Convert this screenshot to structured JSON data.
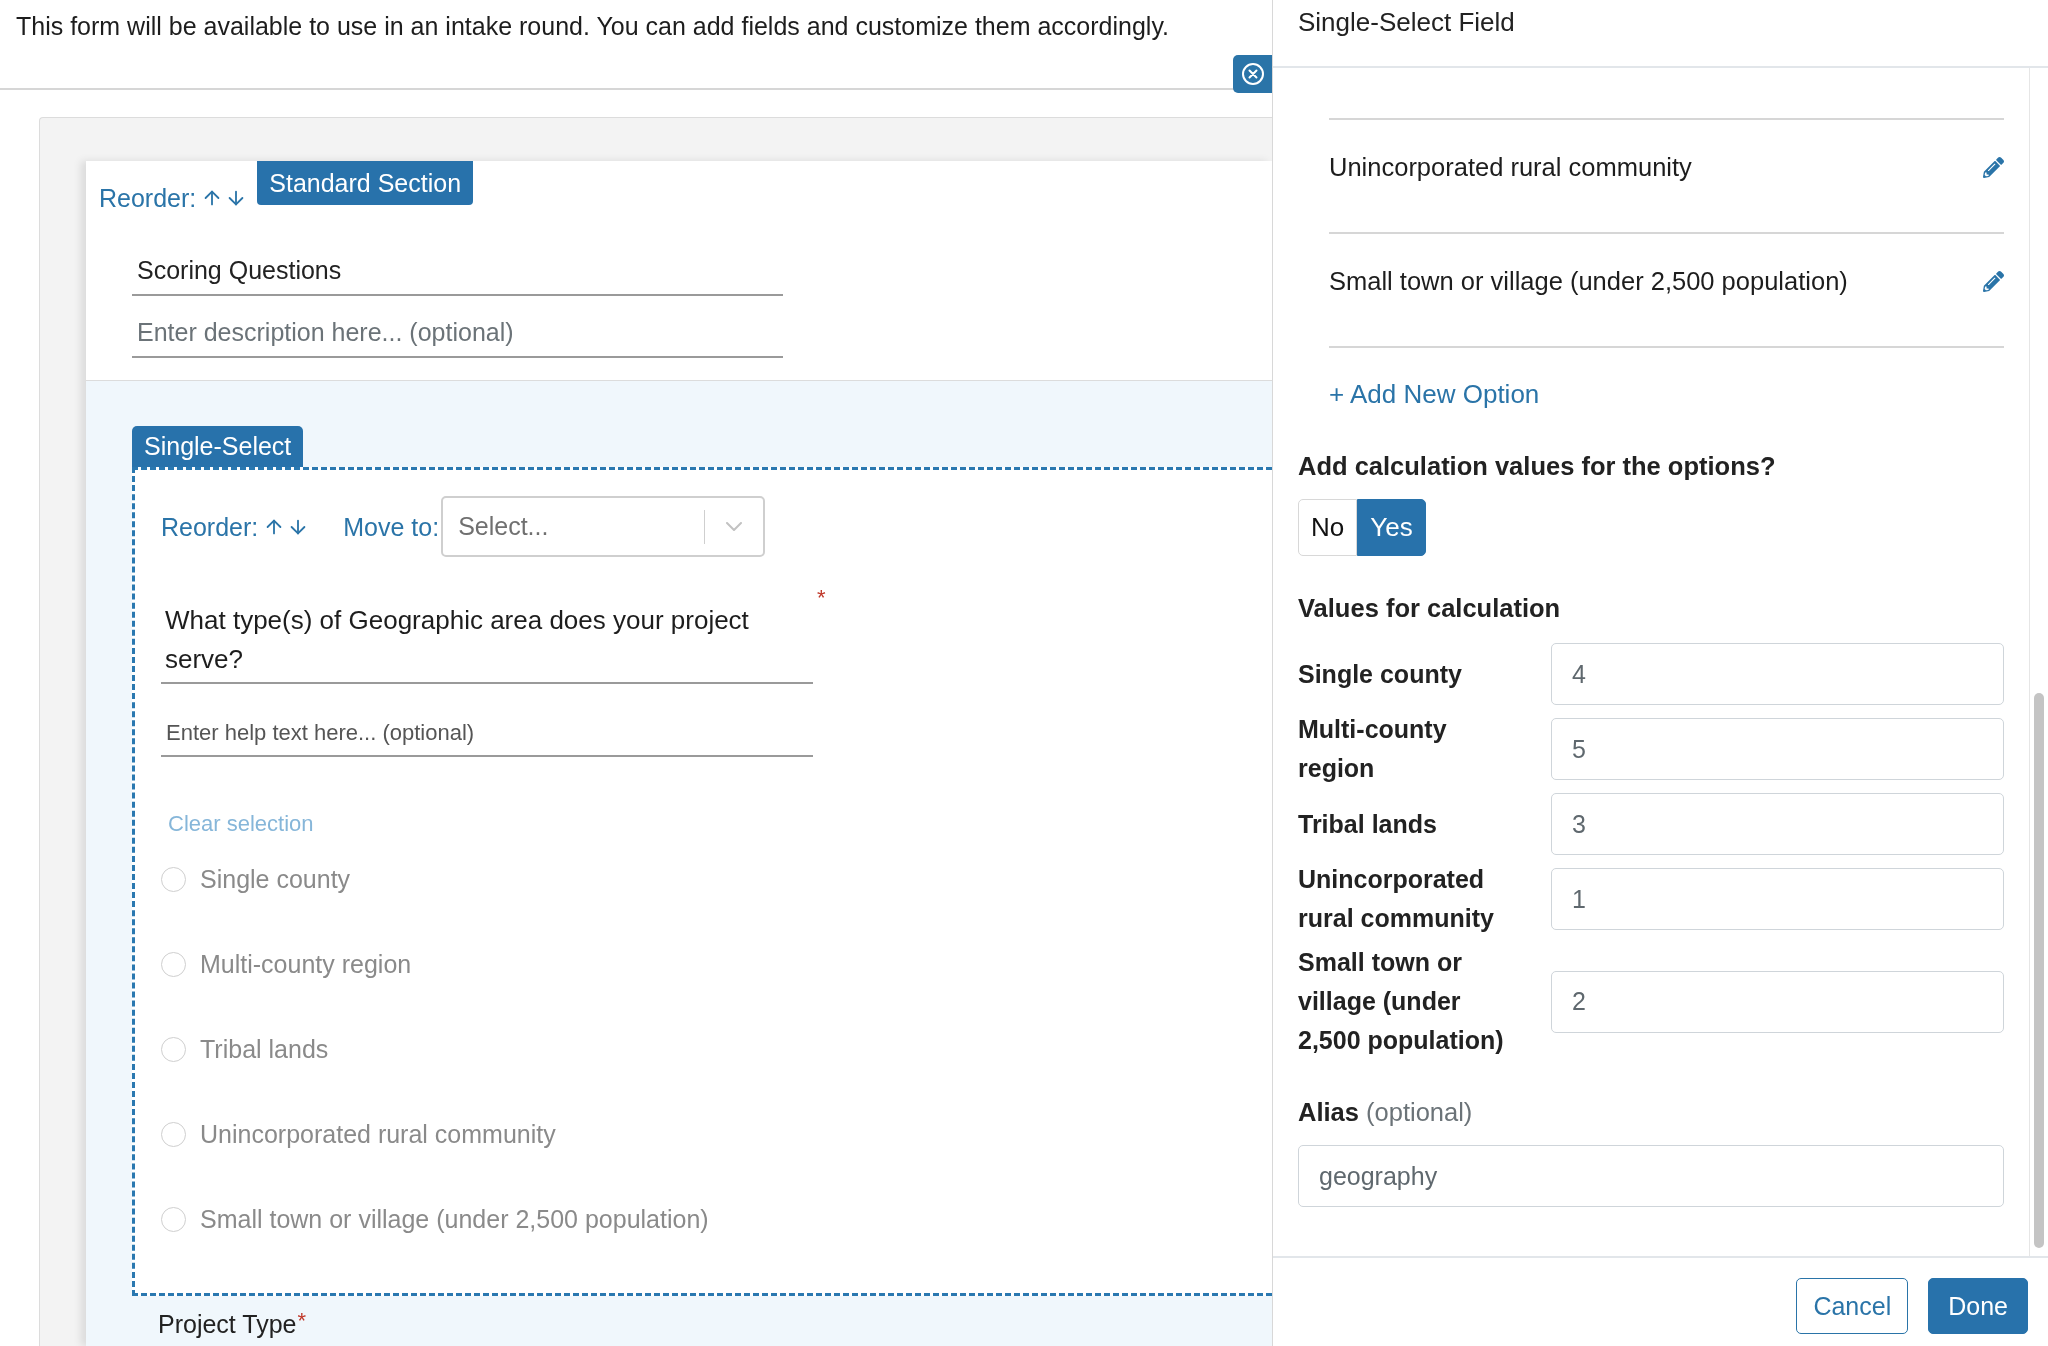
{
  "intro": {
    "text": "This form will be available to use in an intake round. You can add fields and customize them accordingly."
  },
  "section": {
    "reorder_label": "Reorder:",
    "tag": "Standard Section",
    "title": "Scoring Questions",
    "description_placeholder": "Enter description here... (optional)"
  },
  "field": {
    "tag": "Single-Select",
    "reorder_label": "Reorder:",
    "move_to_label": "Move to:",
    "move_to_placeholder": "Select...",
    "question": "What type(s) of Geographic area does your project serve?",
    "required_mark": "*",
    "help_placeholder": "Enter help text here... (optional)",
    "clear_selection": "Clear selection",
    "options": [
      {
        "label": "Single county",
        "selected": false
      },
      {
        "label": "Multi-county region",
        "selected": false
      },
      {
        "label": "Tribal lands",
        "selected": false
      },
      {
        "label": "Unincorporated rural community",
        "selected": false
      },
      {
        "label": "Small town or village (under 2,500 population)",
        "selected": false
      }
    ]
  },
  "next_field": {
    "label": "Project Type",
    "required_mark": "*"
  },
  "editor": {
    "title": "Single-Select Field",
    "options": [
      "Unincorporated rural community",
      "Small town or village (under 2,500 population)"
    ],
    "add_option": "+ Add New Option",
    "calculation_question": "Add calculation values for the options?",
    "calculation_toggle": [
      {
        "label": "No",
        "selected": false
      },
      {
        "label": "Yes",
        "selected": true
      }
    ],
    "values_heading": "Values for calculation",
    "values": [
      {
        "label": "Single county",
        "value": "4"
      },
      {
        "label": "Multi-county region",
        "value": "5"
      },
      {
        "label": "Tribal lands",
        "value": "3"
      },
      {
        "label": "Unincorporated rural community",
        "value": "1"
      },
      {
        "label": "Small town or village (under 2,500 population)",
        "value": "2"
      }
    ],
    "alias": {
      "label": "Alias",
      "hint": "(optional)",
      "value": "geography"
    },
    "buttons": [
      {
        "label": "Cancel",
        "kind": "secondary"
      },
      {
        "label": "Done",
        "kind": "primary"
      }
    ]
  }
}
